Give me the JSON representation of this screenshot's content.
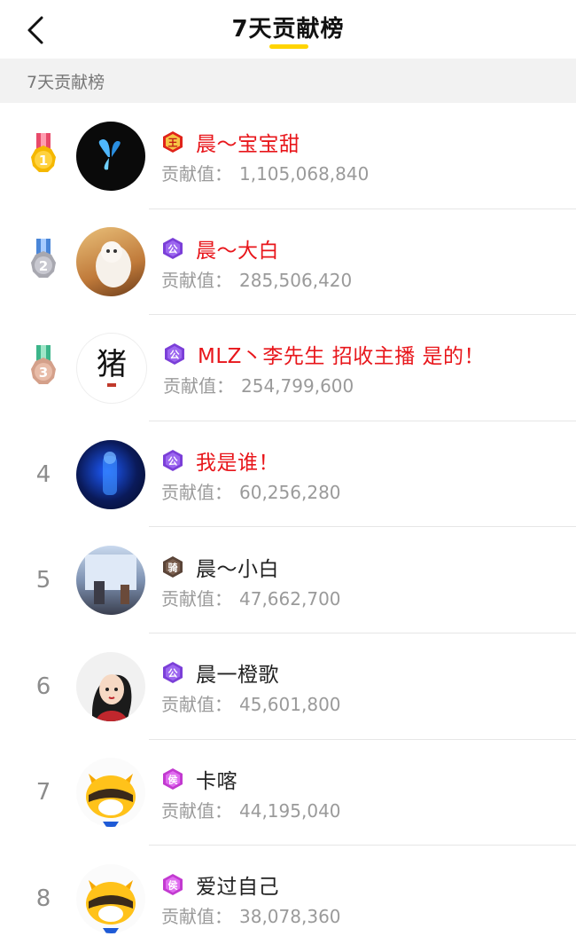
{
  "header": {
    "title": "7天贡献榜"
  },
  "section_label": "7天贡献榜",
  "score_label": "贡献值：",
  "colors": {
    "accent": "#FFD400",
    "name_red": "#e8161b",
    "gold": "#F5B800",
    "silver": "#A8A8B0",
    "bronze": "#D4A08A"
  },
  "ranking": [
    {
      "rank": "1",
      "name": "晨～宝宝甜",
      "score": "1,105,068,840",
      "badge": "王",
      "badge_icon": "king-badge-icon",
      "highlight": true
    },
    {
      "rank": "2",
      "name": "晨～大白",
      "score": "285,506,420",
      "badge": "公",
      "badge_icon": "duke-badge-icon",
      "highlight": true
    },
    {
      "rank": "3",
      "name": "MLZ丶李先生 招收主播 是的！",
      "score": "254,799,600",
      "badge": "公",
      "badge_icon": "duke-badge-icon",
      "highlight": true
    },
    {
      "rank": "4",
      "name": "我是谁！",
      "score": "60,256,280",
      "badge": "公",
      "badge_icon": "duke-badge-icon",
      "highlight": true
    },
    {
      "rank": "5",
      "name": "晨～小白",
      "score": "47,662,700",
      "badge": "骑",
      "badge_icon": "knight-badge-icon",
      "highlight": false
    },
    {
      "rank": "6",
      "name": "晨一橙歌",
      "score": "45,601,800",
      "badge": "公",
      "badge_icon": "duke-badge-icon",
      "highlight": false
    },
    {
      "rank": "7",
      "name": "卡喀",
      "score": "44,195,040",
      "badge": "侯",
      "badge_icon": "marquis-badge-icon",
      "highlight": false
    },
    {
      "rank": "8",
      "name": "爱过自己",
      "score": "38,078,360",
      "badge": "侯",
      "badge_icon": "marquis-badge-icon",
      "highlight": false
    }
  ],
  "avatar_art": {
    "avatar3_text": "猪"
  }
}
